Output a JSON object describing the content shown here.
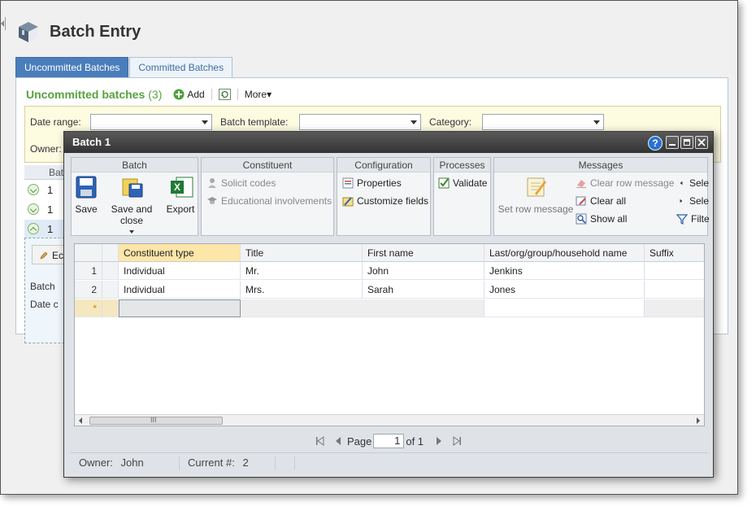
{
  "page": {
    "title": "Batch Entry"
  },
  "tabs": [
    {
      "label": "Uncommitted Batches",
      "active": true
    },
    {
      "label": "Committed Batches",
      "active": false
    }
  ],
  "list": {
    "title": "Uncommitted batches",
    "count": "(3)",
    "add_label": "Add",
    "more_label": "More▾",
    "filters": {
      "date_range_label": "Date range:",
      "batch_template_label": "Batch template:",
      "category_label": "Category:",
      "owner_label": "Owner:"
    },
    "column_partial": "Batc",
    "rows": [
      "1",
      "1",
      "1"
    ],
    "expanded_edit_partial": "Ec",
    "expanded_batch_partial": "Batch",
    "expanded_date_partial": "Date c"
  },
  "dialog": {
    "title": "Batch 1",
    "ribbon": {
      "batch": {
        "header": "Batch",
        "save": "Save",
        "save_close": "Save and close",
        "export": "Export"
      },
      "constituent": {
        "header": "Constituent",
        "solicit": "Solicit codes",
        "educational": "Educational involvements"
      },
      "configuration": {
        "header": "Configuration",
        "properties": "Properties",
        "customize": "Customize fields"
      },
      "processes": {
        "header": "Processes",
        "validate": "Validate"
      },
      "messages": {
        "header": "Messages",
        "set_row": "Set row message",
        "clear_row": "Clear row message",
        "clear_all": "Clear all",
        "show_all": "Show all",
        "sele1": "Sele",
        "sele2": "Sele",
        "filte": "Filte"
      }
    },
    "grid": {
      "columns": [
        "Constituent type",
        "Title",
        "First name",
        "Last/org/group/household name",
        "Suffix"
      ],
      "rows": [
        {
          "n": "1",
          "type": "Individual",
          "title": "Mr.",
          "first": "John",
          "last": "Jenkins",
          "suffix": ""
        },
        {
          "n": "2",
          "type": "Individual",
          "title": "Mrs.",
          "first": "Sarah",
          "last": "Jones",
          "suffix": ""
        }
      ],
      "new_row_marker": "*",
      "scroll_thumb_text": "III"
    },
    "pager": {
      "page_label": "Page",
      "page_value": "1",
      "of_label": "of 1"
    },
    "status": {
      "owner_label": "Owner:",
      "owner_value": "John",
      "current_label": "Current #:",
      "current_value": "2"
    }
  },
  "colors": {
    "accent_green": "#57a33e",
    "tab_active": "#4a7dbb",
    "titlebar": "#333333"
  }
}
